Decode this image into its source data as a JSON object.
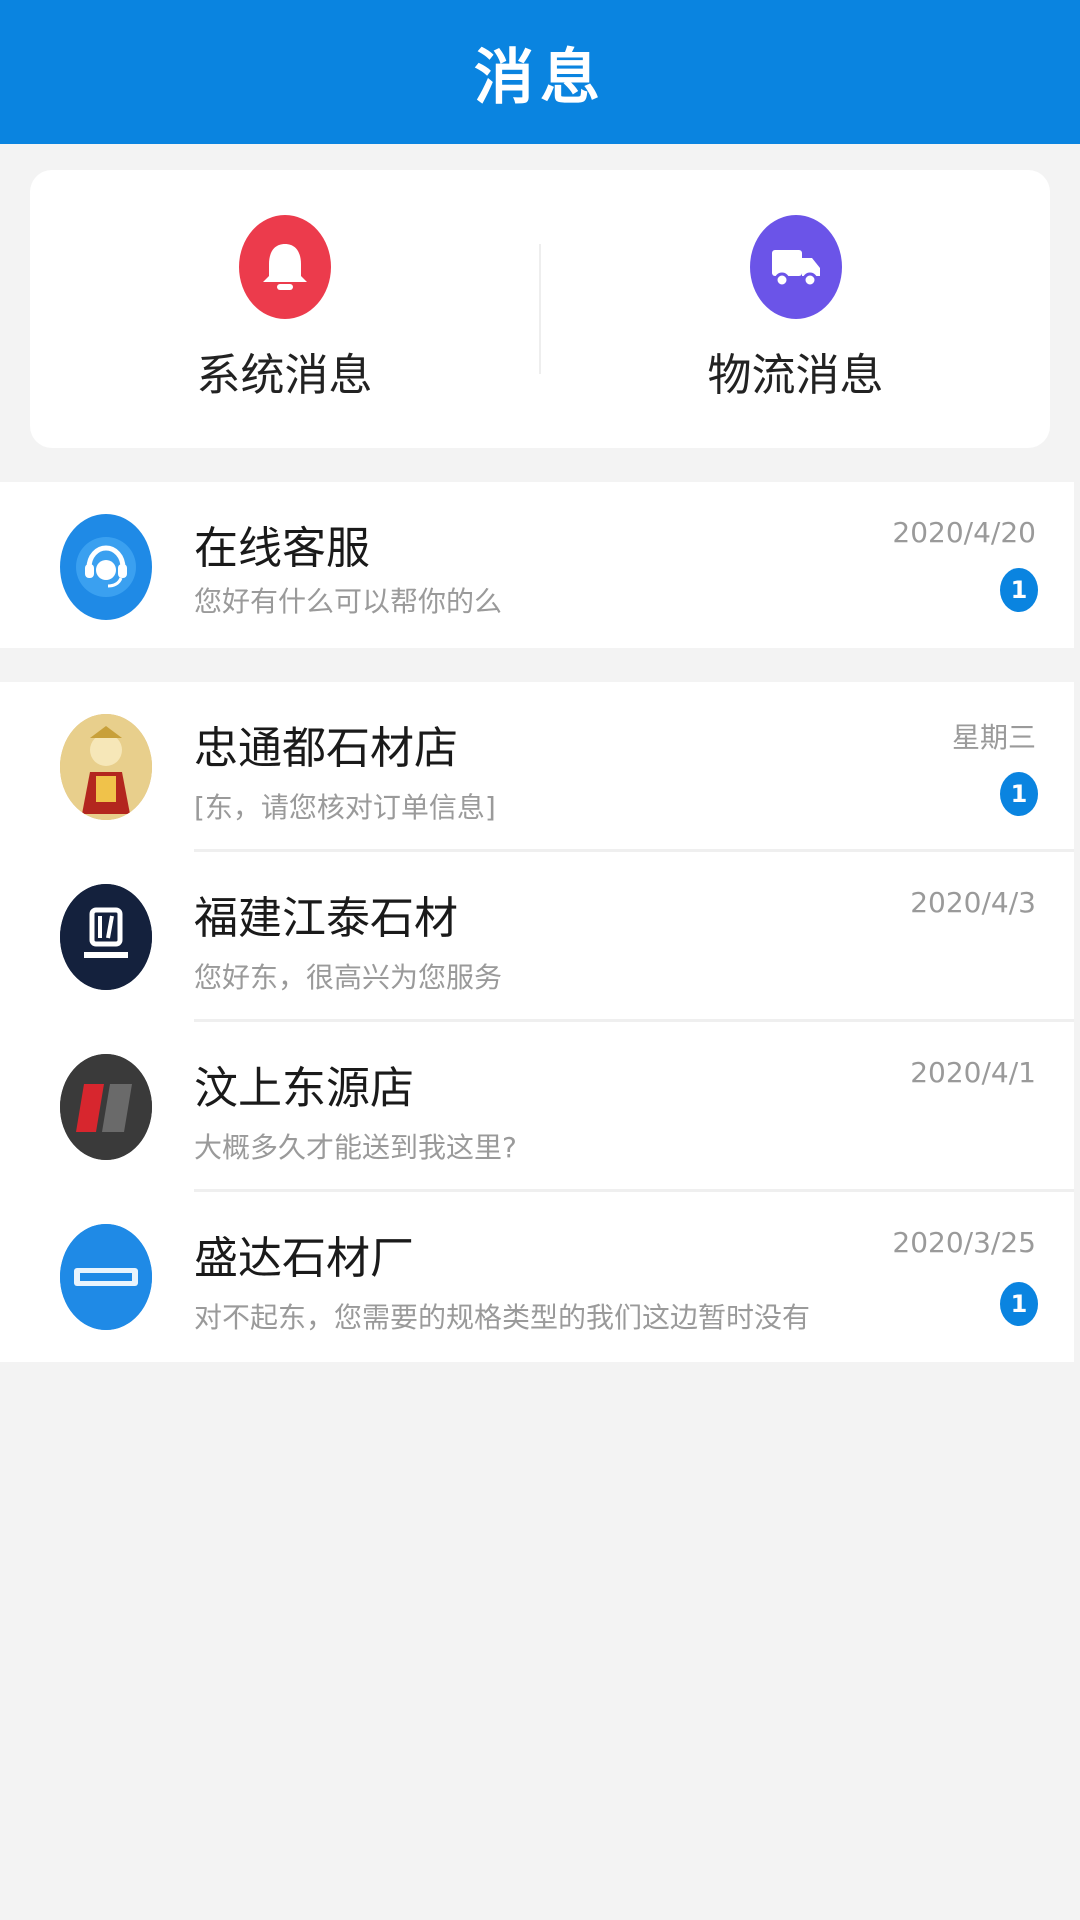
{
  "header": {
    "title": "消息"
  },
  "quick": {
    "system": {
      "label": "系统消息",
      "icon": "bell-icon",
      "color": "#ec3b4c"
    },
    "logistics": {
      "label": "物流消息",
      "icon": "truck-icon",
      "color": "#6b54e8"
    }
  },
  "service": {
    "title": "在线客服",
    "preview": "您好有什么可以帮你的么",
    "time": "2020/4/20",
    "badge": "1",
    "icon": "headset-icon"
  },
  "conversations": [
    {
      "title": "忠通都石材店",
      "preview": "[东，请您核对订单信息]",
      "time": "星期三",
      "badge": "1",
      "avatar": "shop-avatar-icon",
      "avatar_color": "#d9b36a"
    },
    {
      "title": "福建江泰石材",
      "preview": "您好东，很高兴为您服务",
      "time": "2020/4/3",
      "badge": "",
      "avatar": "shop-avatar-icon",
      "avatar_color": "#14213d"
    },
    {
      "title": "汶上东源店",
      "preview": "大概多久才能送到我这里?",
      "time": "2020/4/1",
      "badge": "",
      "avatar": "shop-avatar-icon",
      "avatar_color": "#3a3a3a"
    },
    {
      "title": "盛达石材厂",
      "preview": "对不起东，您需要的规格类型的我们这边暂时没有",
      "time": "2020/3/25",
      "badge": "1",
      "avatar": "shop-avatar-icon",
      "avatar_color": "#1f8ae6"
    }
  ],
  "colors": {
    "brand": "#0a84e0",
    "background": "#f3f3f3"
  }
}
